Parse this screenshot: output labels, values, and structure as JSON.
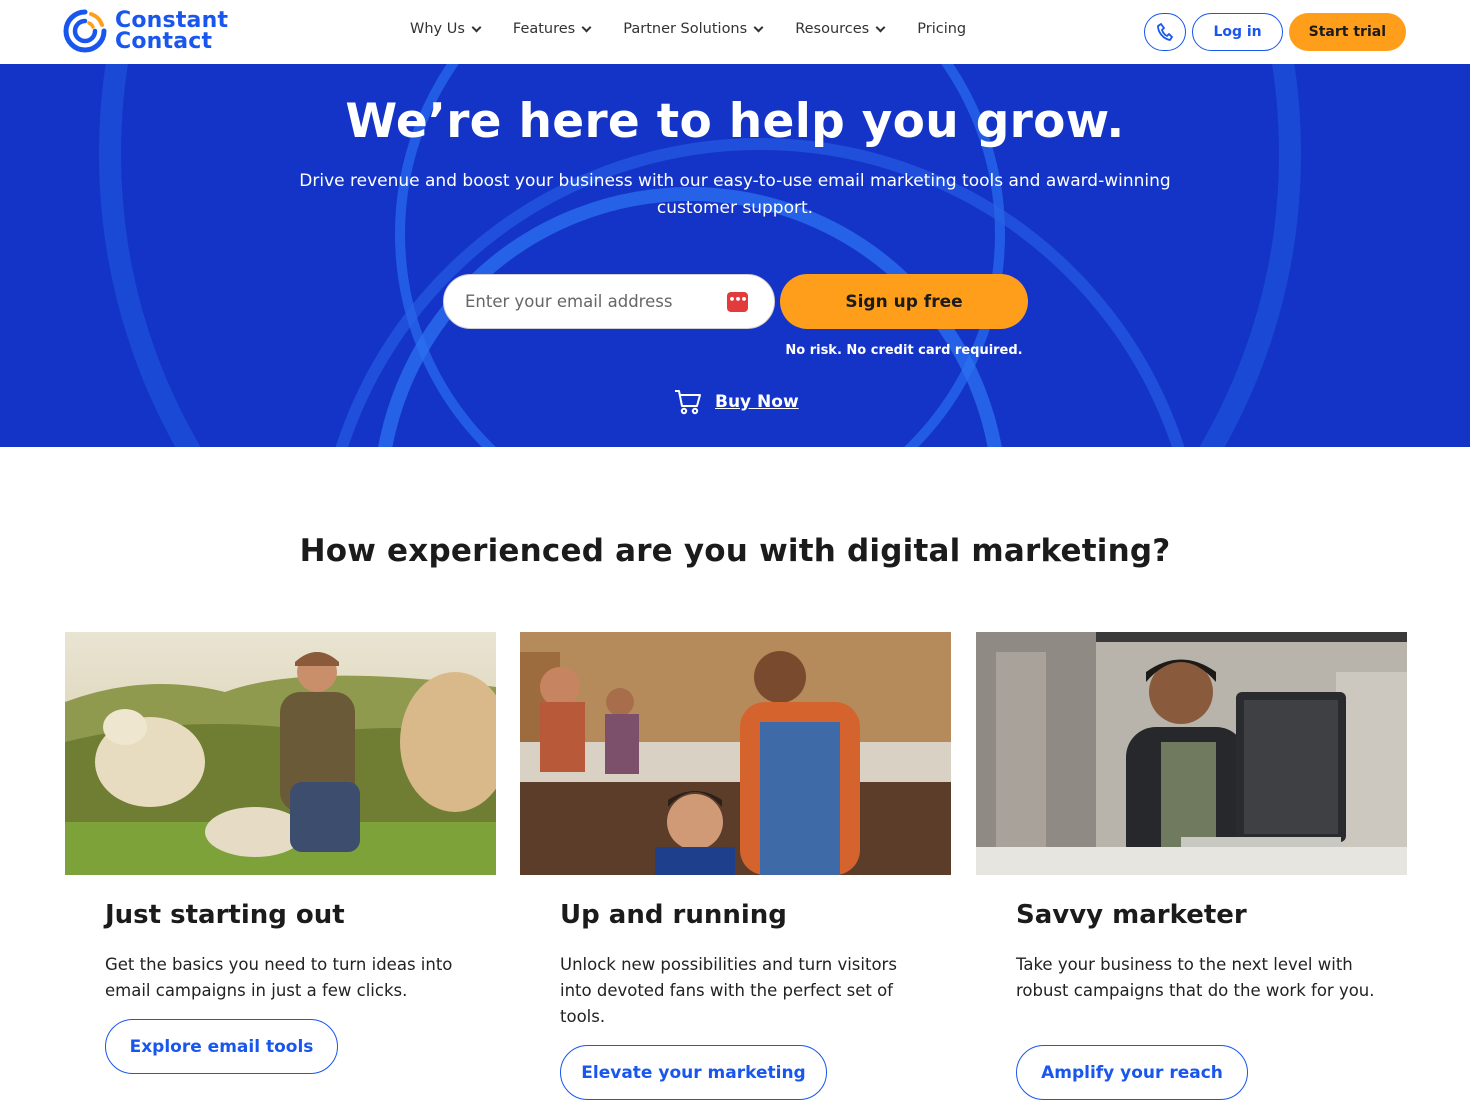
{
  "brand": {
    "line1": "Constant",
    "line2": "Contact",
    "primary_color": "#1856ed",
    "accent_color": "#ff9e1b",
    "hero_color": "#1434c8"
  },
  "nav": {
    "items": [
      {
        "label": "Why Us",
        "has_dropdown": true
      },
      {
        "label": "Features",
        "has_dropdown": true
      },
      {
        "label": "Partner Solutions",
        "has_dropdown": true
      },
      {
        "label": "Resources",
        "has_dropdown": true
      },
      {
        "label": "Pricing",
        "has_dropdown": false
      }
    ],
    "phone_icon": "phone-icon",
    "login_label": "Log in",
    "trial_label": "Start trial"
  },
  "hero": {
    "title": "We’re here to help you grow.",
    "subtitle": "Drive revenue and boost your business with our easy-to-use email marketing tools and award-winning customer support.",
    "email_placeholder": "Enter your email address",
    "signup_label": "Sign up free",
    "norisk_text": "No risk. No credit card required.",
    "buy_now_label": "Buy Now"
  },
  "section": {
    "title": "How experienced are you with digital marketing?",
    "cards": [
      {
        "title": "Just starting out",
        "text": "Get the basics you need to turn ideas into email campaigns in just a few clicks.",
        "button": "Explore email tools",
        "image": "farmer-with-goats-photo"
      },
      {
        "title": "Up and running",
        "text": "Unlock new possibilities and turn visitors into devoted fans with the perfect set of tools.",
        "button": "Elevate your marketing",
        "image": "barber-cutting-hair-photo"
      },
      {
        "title": "Savvy marketer",
        "text": "Take your business to the next level with robust campaigns that do the work for you.",
        "button": "Amplify your reach",
        "image": "woman-at-computer-photo"
      }
    ]
  }
}
